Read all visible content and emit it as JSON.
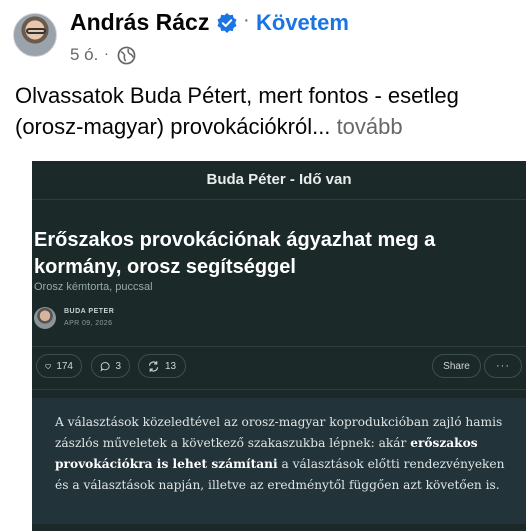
{
  "post": {
    "author_name": "András Rácz",
    "follow_label": "Követem",
    "time": "5 ó.",
    "text": "Olvassatok Buda Pétert, mert fontos - esetleg (orosz-magyar) provokációkról...",
    "more_label": "tovább",
    "icons": {
      "verified": "verified-badge-icon",
      "privacy": "globe-icon"
    }
  },
  "card": {
    "publication": "Buda Péter - Idő van",
    "title": "Erőszakos provokációnak ágyazhat meg a kormány, orosz segítséggel",
    "subtitle": "Orosz kémtorta, puccsal",
    "author": "BUDA PETER",
    "date": "APR 09, 2026",
    "likes": "174",
    "comments": "3",
    "restacks": "13",
    "share_label": "Share",
    "more_label": "···",
    "excerpt_part1": "A választások közeledtével az orosz-magyar koprodukcióban zajló hamis zászlós műveletek a következő szakaszukba lépnek: akár ",
    "excerpt_bold": "erőszakos provokációkra is lehet számítani",
    "excerpt_part2": " a választások előtti rendezvényeken és a választások napján, illetve az eredménytől függően azt követően is."
  },
  "colors": {
    "follow": "#1b74e4",
    "card_bg": "#1b2a29",
    "excerpt_bg": "#22333a"
  }
}
